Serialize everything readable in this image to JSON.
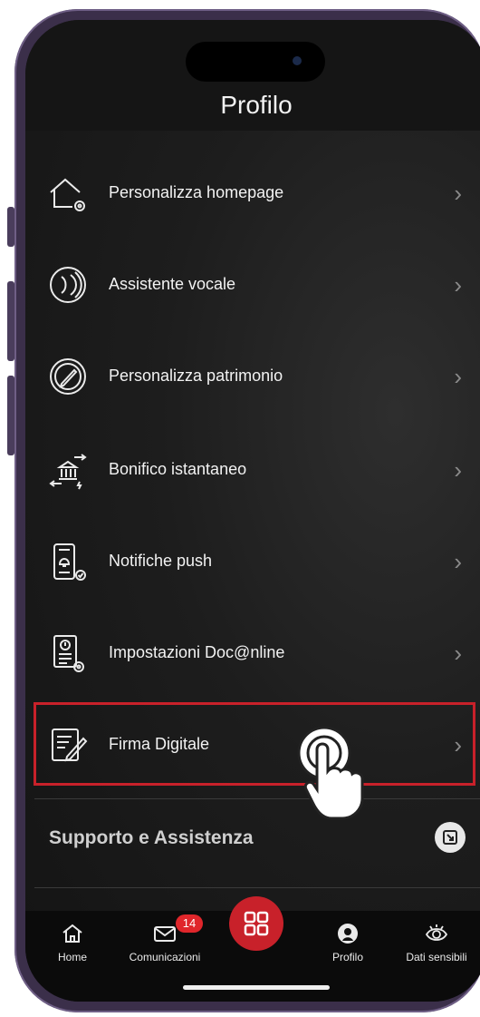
{
  "header": {
    "title": "Profilo"
  },
  "menu": {
    "items": [
      {
        "label": "Personalizza homepage",
        "icon": "home-settings-icon"
      },
      {
        "label": "Assistente vocale",
        "icon": "voice-assistant-icon"
      },
      {
        "label": "Personalizza patrimonio",
        "icon": "edit-circle-icon"
      },
      {
        "label": "Bonifico istantaneo",
        "icon": "bank-transfer-icon"
      },
      {
        "label": "Notifiche push",
        "icon": "phone-bell-icon"
      },
      {
        "label": "Impostazioni Doc@nline",
        "icon": "document-settings-icon"
      },
      {
        "label": "Firma Digitale",
        "icon": "signature-document-icon"
      }
    ]
  },
  "section": {
    "title": "Supporto e Assistenza"
  },
  "tabbar": {
    "home_label": "Home",
    "comunicazioni_label": "Comunicazioni",
    "comunicazioni_badge": "14",
    "profilo_label": "Profilo",
    "dati_label": "Dati sensibili"
  },
  "colors": {
    "accent": "#c8212a",
    "background": "#1d1d1d",
    "text": "#f2f2f2"
  }
}
